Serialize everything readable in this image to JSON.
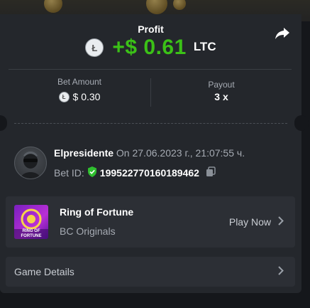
{
  "header": {
    "profit_label": "Profit",
    "profit_value": "+$ 0.61",
    "profit_currency": "LTC",
    "currency_icon": "litecoin-icon",
    "share_icon": "share-icon"
  },
  "bet": {
    "amount_label": "Bet Amount",
    "amount_value": "$ 0.30",
    "payout_label": "Payout",
    "payout_value": "3 x"
  },
  "user": {
    "name": "Elpresidente",
    "on_text": "On 27.06.2023 г., 21:07:55 ч.",
    "bet_id_label": "Bet ID:",
    "bet_id": "199522770160189462"
  },
  "game": {
    "title": "Ring of Fortune",
    "subtitle": "BC Originals",
    "play_label": "Play Now",
    "thumb_text": "RING OF FORTUNE"
  },
  "details": {
    "label": "Game Details"
  },
  "colors": {
    "profit_green": "#3bc117",
    "card_bg": "#24272c",
    "verified_green": "#2fbf2f"
  }
}
